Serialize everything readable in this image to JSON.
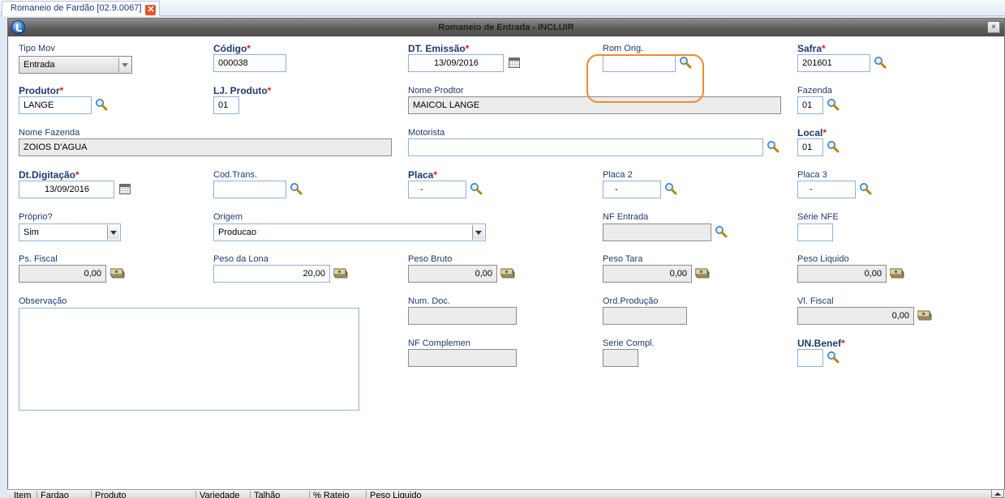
{
  "tab": {
    "label": "Romaneio de Fardão [02.9.0067]",
    "close": "✕"
  },
  "window": {
    "title": "Romaneio de Entrada - INCLUIR",
    "close": "×"
  },
  "fields": {
    "tipo_mov": {
      "label": "Tipo Mov",
      "value": "Entrada"
    },
    "codigo": {
      "label": "Código",
      "value": "000038"
    },
    "dt_emissao": {
      "label": "DT. Emissão",
      "value": "13/09/2016"
    },
    "rom_orig": {
      "label": "Rom Orig.",
      "value": ""
    },
    "safra": {
      "label": "Safra",
      "value": "201601"
    },
    "produtor": {
      "label": "Produtor",
      "value": "LANGE"
    },
    "lj_produto": {
      "label": "LJ. Produto",
      "value": "01"
    },
    "nome_prodtor": {
      "label": "Nome Prodtor",
      "value": "MAICOL LANGE"
    },
    "fazenda": {
      "label": "Fazenda",
      "value": "01"
    },
    "nome_fazenda": {
      "label": "Nome Fazenda",
      "value": "ZOIOS D'AGUA"
    },
    "motorista": {
      "label": "Motorista",
      "value": ""
    },
    "local": {
      "label": "Local",
      "value": "01"
    },
    "dt_digitacao": {
      "label": "Dt.Digitação",
      "value": "13/09/2016"
    },
    "cod_trans": {
      "label": "Cod.Trans.",
      "value": ""
    },
    "placa": {
      "label": "Placa",
      "value": "-"
    },
    "placa2": {
      "label": "Placa 2",
      "value": "-"
    },
    "placa3": {
      "label": "Placa 3",
      "value": "-"
    },
    "proprio": {
      "label": "Próprio?",
      "value": "Sim"
    },
    "origem": {
      "label": "Origem",
      "value": "Producao"
    },
    "nf_entrada": {
      "label": "NF Entrada",
      "value": ""
    },
    "serie_nfe": {
      "label": "Série NFE",
      "value": ""
    },
    "ps_fiscal": {
      "label": "Ps. Fiscal",
      "value": "0,00"
    },
    "peso_lona": {
      "label": "Peso da Lona",
      "value": "20,00"
    },
    "peso_bruto": {
      "label": "Peso Bruto",
      "value": "0,00"
    },
    "peso_tara": {
      "label": "Peso Tara",
      "value": "0,00"
    },
    "peso_liquido": {
      "label": "Peso Liquido",
      "value": "0,00"
    },
    "observacao": {
      "label": "Observação",
      "value": ""
    },
    "num_doc": {
      "label": "Num. Doc.",
      "value": ""
    },
    "ord_producao": {
      "label": "Ord.Produção",
      "value": ""
    },
    "vl_fiscal": {
      "label": "Vl. Fiscal",
      "value": "0,00"
    },
    "nf_complemen": {
      "label": "NF Complemen",
      "value": ""
    },
    "serie_compl": {
      "label": "Serie Compl.",
      "value": ""
    },
    "un_benef": {
      "label": "UN.Benef",
      "value": ""
    }
  },
  "grid": {
    "columns": [
      "Item",
      "Fardao",
      "Produto",
      "Variedade",
      "Talhão",
      "% Rateio",
      "Peso Liquido"
    ]
  },
  "colors": {
    "highlight": "#f08a2c",
    "required_marker": "#e02020",
    "label": "#1d3a6e",
    "input_border": "#8fb2d9"
  }
}
